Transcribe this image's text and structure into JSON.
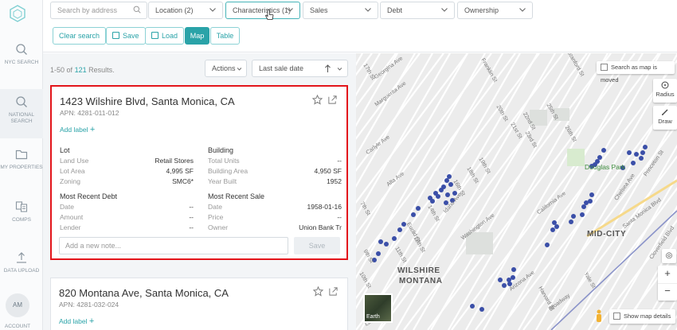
{
  "nav": {
    "items": [
      {
        "label": "NYC SEARCH",
        "active": false
      },
      {
        "label": "NATIONAL SEARCH",
        "active": true
      },
      {
        "label": "MY PROPERTIES",
        "active": false
      },
      {
        "label": "COMPS",
        "active": false
      },
      {
        "label": "DATA UPLOAD",
        "active": false
      }
    ],
    "avatar_initials": "AM",
    "avatar_label": "ACCOUNT"
  },
  "filters": {
    "search_placeholder": "Search by address",
    "location": "Location (2)",
    "characteristics": "Characteristics (1)",
    "sales": "Sales",
    "debt": "Debt",
    "ownership": "Ownership"
  },
  "toolbar": {
    "clear": "Clear search",
    "save": "Save",
    "load": "Load",
    "map": "Map",
    "table": "Table"
  },
  "list": {
    "range": "1-50",
    "of": "of",
    "total": "121",
    "results_word": "Results.",
    "actions": "Actions",
    "sort": "Last sale date"
  },
  "cards": [
    {
      "title": "1423 Wilshire Blvd, Santa Monica, CA",
      "apn": "APN: 4281-011-012",
      "add_label": "Add label",
      "lot": {
        "heading": "Lot",
        "rows": [
          [
            "Land Use",
            "Retail Stores"
          ],
          [
            "Lot Area",
            "4,995 SF"
          ],
          [
            "Zoning",
            "SMC6*"
          ]
        ]
      },
      "building": {
        "heading": "Building",
        "rows": [
          [
            "Total Units",
            "--"
          ],
          [
            "Building Area",
            "4,950 SF"
          ],
          [
            "Year Built",
            "1952"
          ]
        ]
      },
      "debt": {
        "heading": "Most Recent Debt",
        "rows": [
          [
            "Date",
            "--"
          ],
          [
            "Amount",
            "--"
          ],
          [
            "Lender",
            "--"
          ]
        ]
      },
      "sale": {
        "heading": "Most Recent Sale",
        "rows": [
          [
            "Date",
            "1958-01-16"
          ],
          [
            "Price",
            "--"
          ],
          [
            "Owner",
            "Union Bank Tr"
          ]
        ]
      },
      "note_placeholder": "Add a new note...",
      "save_label": "Save"
    },
    {
      "title": "820 Montana Ave, Santa Monica, CA",
      "apn": "APN: 4281-032-024",
      "add_label": "Add label"
    }
  ],
  "map": {
    "search_moved": "Search as map is moved",
    "radius": "Radius",
    "draw": "Draw",
    "show_details": "Show map details",
    "earth": "Earth",
    "districts": [
      "WILSHIRE",
      "MONTANA",
      "MID-CITY"
    ],
    "park": "Douglas Park",
    "streets": [
      "Georgina Ave",
      "Marguerita Ave",
      "Alta Ave",
      "Carlyle Ave",
      "Washington Ave",
      "California Ave",
      "Idaho Ave",
      "Arizona Ave",
      "Santa Monica Blvd",
      "Princeton St",
      "Chelsea Ave",
      "Cloverfield Blvd",
      "Euclid St",
      "11th St",
      "12th St",
      "14th St",
      "16th St",
      "17th St",
      "18th St",
      "19th St",
      "20th St",
      "21st St",
      "22nd St",
      "23rd St",
      "25th St",
      "26th St",
      "7th St",
      "9th St",
      "10th St",
      "Lincoln Blvd",
      "Franklin St",
      "Stanford St",
      "Yale St",
      "Harvard St",
      "Broadway"
    ],
    "dot_color": "#3b4fa8"
  },
  "colors": {
    "accent": "#2aa3a8",
    "highlight": "#e3151b"
  }
}
